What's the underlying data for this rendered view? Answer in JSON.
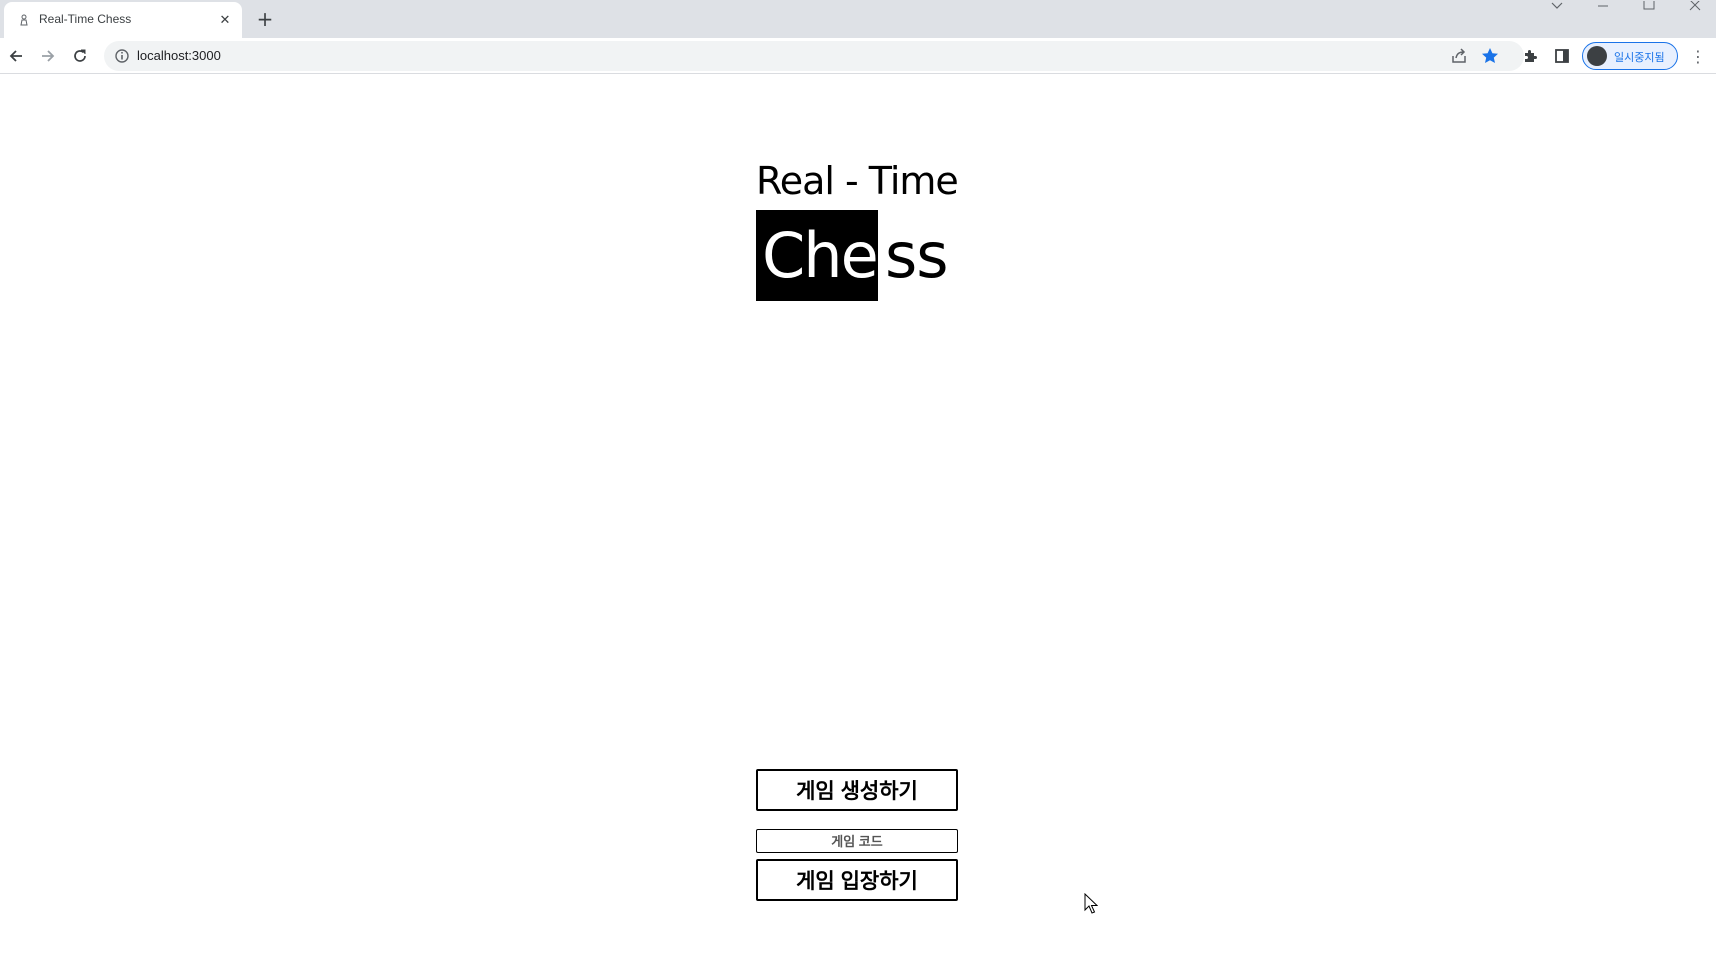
{
  "browser": {
    "tab_title": "Real-Time Chess",
    "new_tab": "+",
    "close": "✕",
    "url": "localhost:3000",
    "profile_label": "일시중지됨",
    "menu": "⋮"
  },
  "logo": {
    "line1": "Real - Time",
    "highlight": "Che",
    "rest": "ss"
  },
  "actions": {
    "create_game": "게임 생성하기",
    "game_code_placeholder": "게임 코드",
    "join_game": "게임 입장하기"
  },
  "colors": {
    "accent": "#1a73e8",
    "logo_bg": "#000000",
    "logo_fg": "#ffffff"
  }
}
